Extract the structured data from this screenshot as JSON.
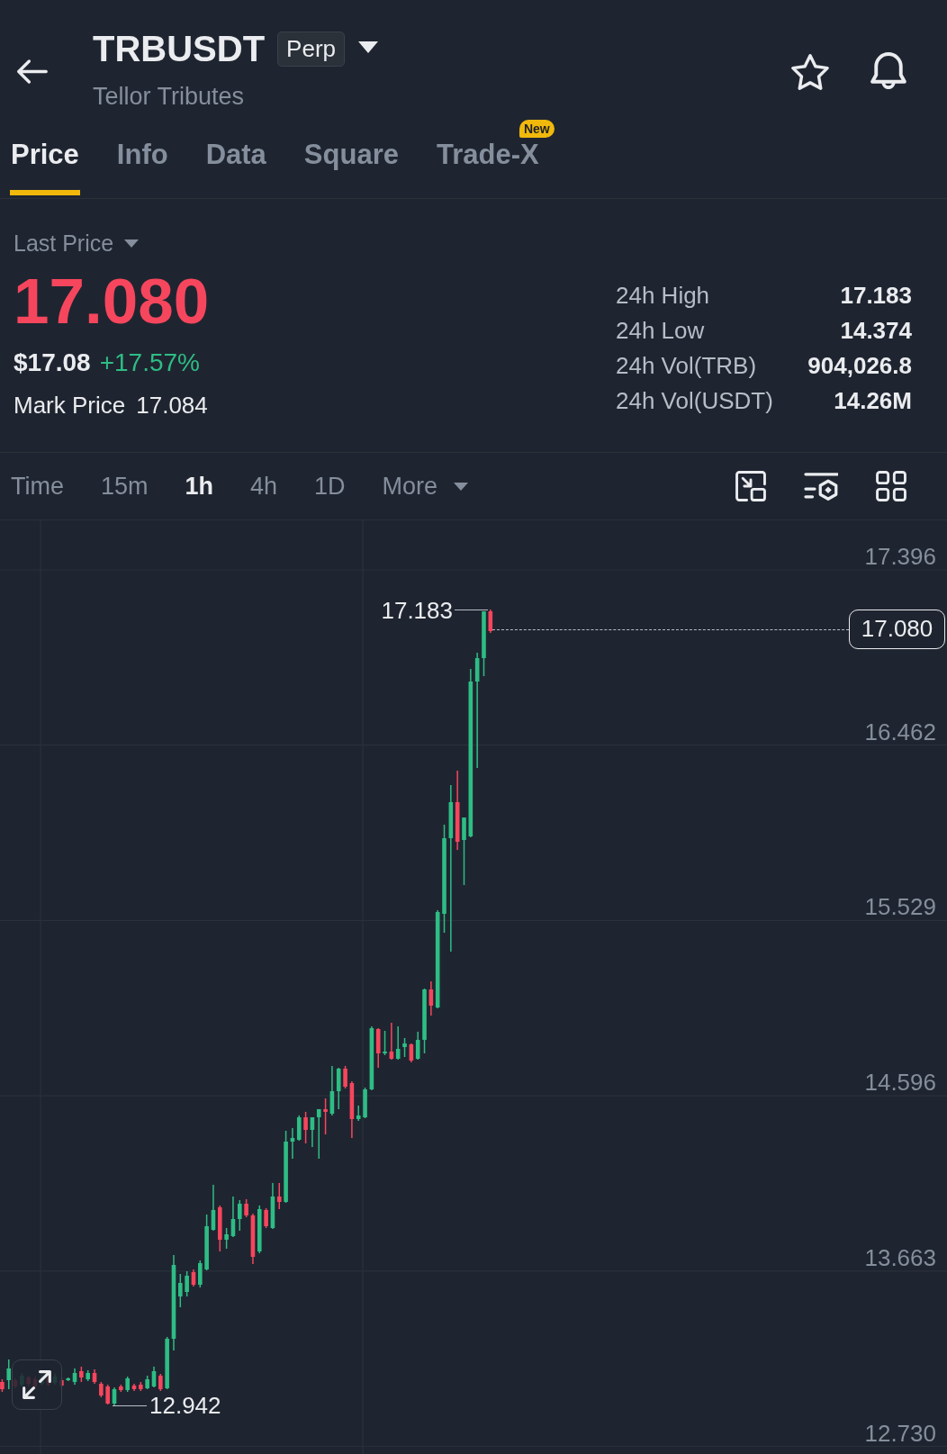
{
  "header": {
    "symbol": "TRBUSDT",
    "contract_type": "Perp",
    "full_name": "Tellor Tributes"
  },
  "tabs": [
    {
      "label": "Price",
      "selected": true
    },
    {
      "label": "Info",
      "selected": false
    },
    {
      "label": "Data",
      "selected": false
    },
    {
      "label": "Square",
      "selected": false
    },
    {
      "label": "Trade-X",
      "selected": false,
      "badge": "New"
    }
  ],
  "price_panel": {
    "price_type": "Last Price",
    "last_price": "17.080",
    "last_tick_up": false,
    "usd_price": "$17.08",
    "change": "+17.57%",
    "change_positive": true,
    "mark_price_label": "Mark Price",
    "mark_price": "17.084",
    "stats": [
      {
        "label": "24h High",
        "value": "17.183"
      },
      {
        "label": "24h Low",
        "value": "14.374"
      },
      {
        "label": "24h Vol(TRB)",
        "value": "904,026.8"
      },
      {
        "label": "24h Vol(USDT)",
        "value": "14.26M"
      }
    ]
  },
  "intervals": [
    {
      "kind": "interval",
      "label": "Time",
      "selected": false
    },
    {
      "kind": "interval",
      "label": "15m",
      "selected": false
    },
    {
      "kind": "interval",
      "label": "1h",
      "selected": true
    },
    {
      "kind": "interval",
      "label": "4h",
      "selected": false
    },
    {
      "kind": "interval",
      "label": "1D",
      "selected": false
    },
    {
      "kind": "menu",
      "label": "More",
      "selected": false
    }
  ],
  "chart": {
    "price_axis": [
      "17.396",
      "16.462",
      "15.529",
      "14.596",
      "13.663",
      "12.730"
    ],
    "high_marker": "17.183",
    "low_marker": "12.942",
    "last_price_tag": "17.080"
  }
}
